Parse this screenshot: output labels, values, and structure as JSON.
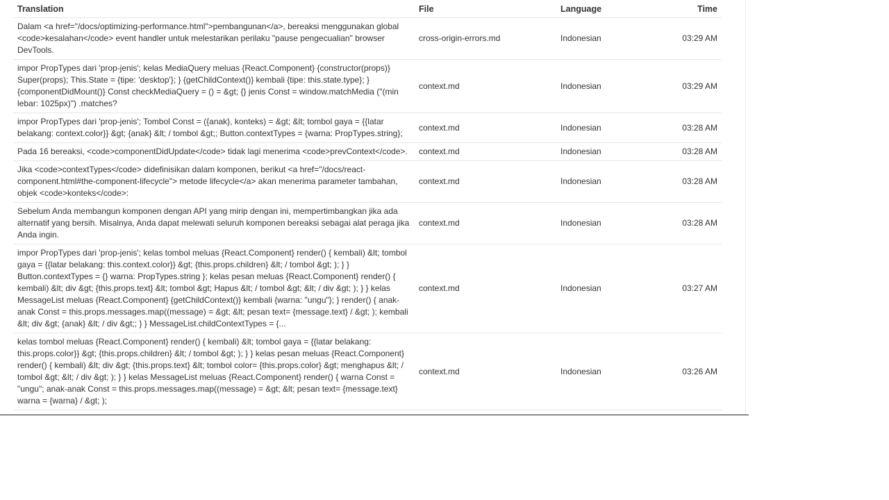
{
  "headers": {
    "translation": "Translation",
    "file": "File",
    "language": "Language",
    "time": "Time"
  },
  "colors": {
    "translation_text": "#6aa84f",
    "body_text": "#333333",
    "row_border": "#e6e6e6"
  },
  "rows": [
    {
      "translation": "Dalam <a href=\"/docs/optimizing-performance.html\">pembangunan</a>, bereaksi menggunakan global <code>kesalahan</code> event handler untuk melestarikan perilaku \"pause pengecualian\" browser DevTools.",
      "file": "cross-origin-errors.md",
      "language": "Indonesian",
      "time": "03:29 AM"
    },
    {
      "translation": "impor PropTypes dari 'prop-jenis'; kelas MediaQuery meluas {React.Component} {constructor(props)} Super(props); This.State = {tipe: 'desktop'}; } {getChildContext()} kembali {tipe: this.state.type}; } {componentDidMount()} Const checkMediaQuery = () = &gt; {} jenis Const = window.matchMedia (\"(min lebar: 1025px)\") .matches?",
      "file": "context.md",
      "language": "Indonesian",
      "time": "03:29 AM"
    },
    {
      "translation": "impor PropTypes dari 'prop-jenis'; Tombol Const = ({anak}, konteks) = &gt; &lt; tombol gaya = {{latar belakang: context.color}} &gt; {anak} &lt; / tombol &gt;; Button.contextTypes = {warna: PropTypes.string};",
      "file": "context.md",
      "language": "Indonesian",
      "time": "03:28 AM"
    },
    {
      "translation": "Pada 16 bereaksi, <code>componentDidUpdate</code> tidak lagi menerima <code>prevContext</code>.",
      "file": "context.md",
      "language": "Indonesian",
      "time": "03:28 AM"
    },
    {
      "translation": "Jika <code>contextTypes</code> didefinisikan dalam komponen, berikut <a href=\"/docs/react-component.html#the-component-lifecycle\"> metode lifecycle</a> akan menerima parameter tambahan, objek <code>konteks</code>:",
      "file": "context.md",
      "language": "Indonesian",
      "time": "03:28 AM"
    },
    {
      "translation": "Sebelum Anda membangun komponen dengan API yang mirip dengan ini, mempertimbangkan jika ada alternatif yang bersih. Misalnya, Anda dapat melewati seluruh komponen bereaksi sebagai alat peraga jika Anda ingin.",
      "file": "context.md",
      "language": "Indonesian",
      "time": "03:28 AM"
    },
    {
      "translation": "impor PropTypes dari 'prop-jenis'; kelas tombol meluas {React.Component} render() { kembali) &lt; tombol gaya = {{latar belakang: this.context.color}} &gt; {this.props.children} &lt; / tombol &gt; ); } } Button.contextTypes = {} warna: PropTypes.string }; kelas pesan meluas {React.Component} render() { kembali) &lt; div &gt; {this.props.text} &lt; tombol &gt; Hapus &lt; / tombol &gt; &lt; / div &gt; ); } } kelas MessageList meluas {React.Component} {getChildContext()} kembali {warna: \"ungu\"}; } render() { anak-anak Const = this.props.messages.map((message) = &gt; &lt; pesan text= {message.text} / &gt; ); kembali &lt; div &gt; {anak} &lt; / div &gt;; } } MessageList.childContextTypes = {...",
      "file": "context.md",
      "language": "Indonesian",
      "time": "03:27 AM"
    },
    {
      "translation": "kelas tombol meluas {React.Component} render() { kembali) &lt; tombol gaya = {{latar belakang: this.props.color}} &gt; {this.props.children} &lt; / tombol &gt; ); } } kelas pesan meluas {React.Component} render() { kembali) &lt; div &gt; {this.props.text} &lt; tombol color= {this.props.color} &gt; menghapus &lt; / tombol &gt; &lt; / div &gt; ); } } kelas MessageList meluas {React.Component} render() { warna Const = \"ungu\"; anak-anak Const = this.props.messages.map((message) = &gt; &lt; pesan text= {message.text} warna = {warna} / &gt; );",
      "file": "context.md",
      "language": "Indonesian",
      "time": "03:26 AM"
    }
  ]
}
